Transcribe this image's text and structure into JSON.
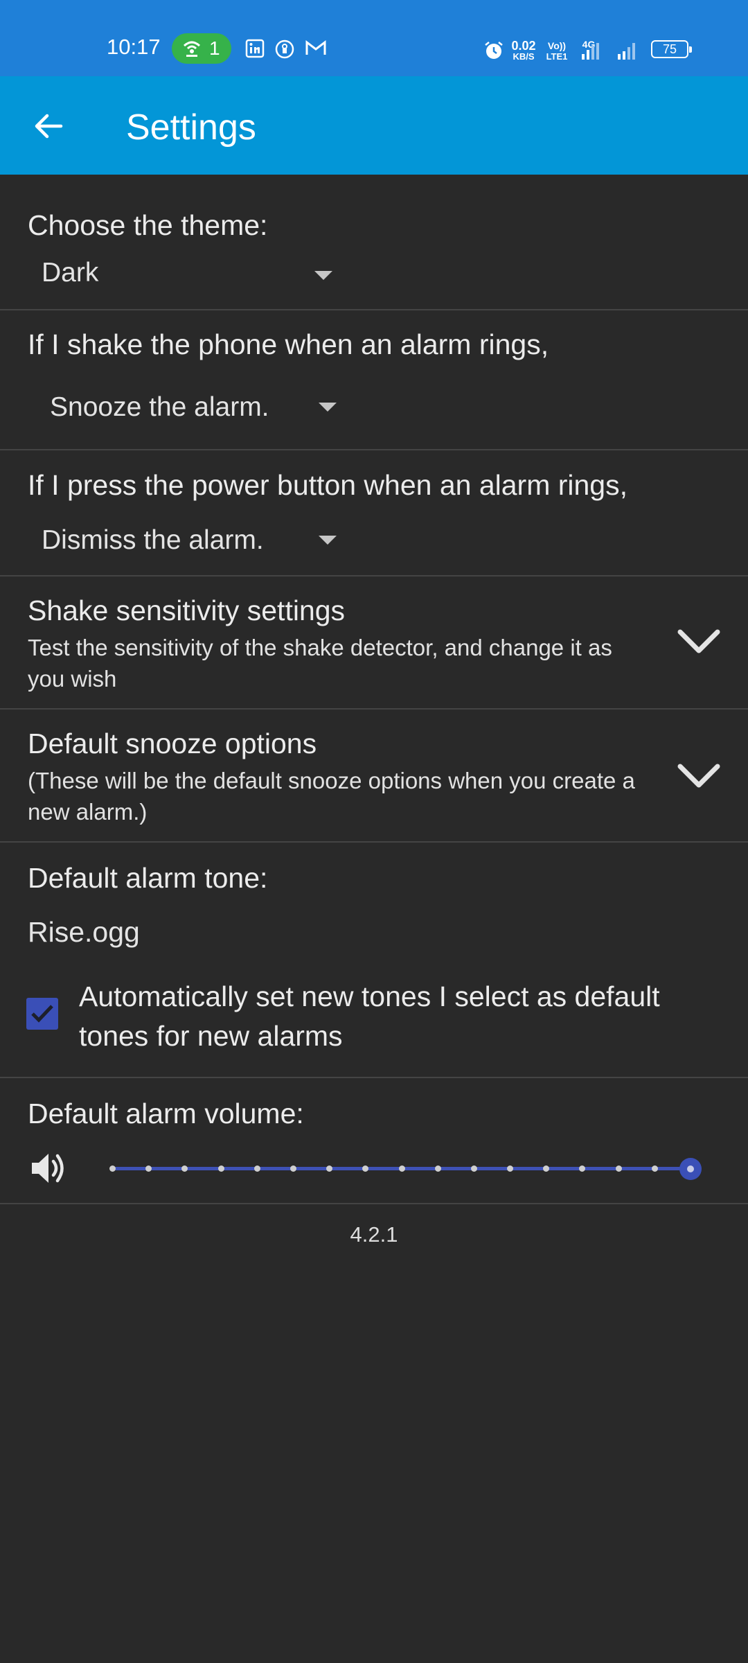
{
  "status_bar": {
    "time": "10:17",
    "hotspot_count": "1",
    "net_speed_value": "0.02",
    "net_speed_unit": "KB/S",
    "volte_top": "Vo))",
    "volte_bottom": "LTE1",
    "network_type": "4G",
    "battery": "75",
    "icons": [
      "hotspot-icon",
      "linkedin-icon",
      "password-manager-icon",
      "gmail-icon",
      "alarm-icon",
      "signal-icon"
    ]
  },
  "app_bar": {
    "title": "Settings",
    "back_icon": "arrow-left-icon"
  },
  "theme": {
    "label": "Choose the theme:",
    "value": "Dark"
  },
  "shake": {
    "label": "If I shake the phone when an alarm rings,",
    "value": "Snooze the alarm."
  },
  "power": {
    "label": "If I press the power button when an alarm rings,",
    "value": "Dismiss the alarm."
  },
  "shake_sensitivity": {
    "title": "Shake sensitivity settings",
    "description": "Test the sensitivity of the shake detector, and change it as you wish"
  },
  "snooze_options": {
    "title": "Default snooze options",
    "description": "(These will be the default snooze options when you create a new alarm.)"
  },
  "alarm_tone": {
    "label": "Default alarm tone:",
    "value": "Rise.ogg",
    "auto_set_label": "Automatically set new tones I select as default tones for new alarms",
    "auto_set_checked": true
  },
  "alarm_volume": {
    "label": "Default alarm volume:",
    "level": 1.0,
    "steps": 17
  },
  "version": "4.2.1",
  "colors": {
    "status_bar": "#1f80d8",
    "app_bar": "#0396d7",
    "background": "#292929",
    "accent": "#3a4fb7",
    "hotspot": "#36b24a"
  }
}
